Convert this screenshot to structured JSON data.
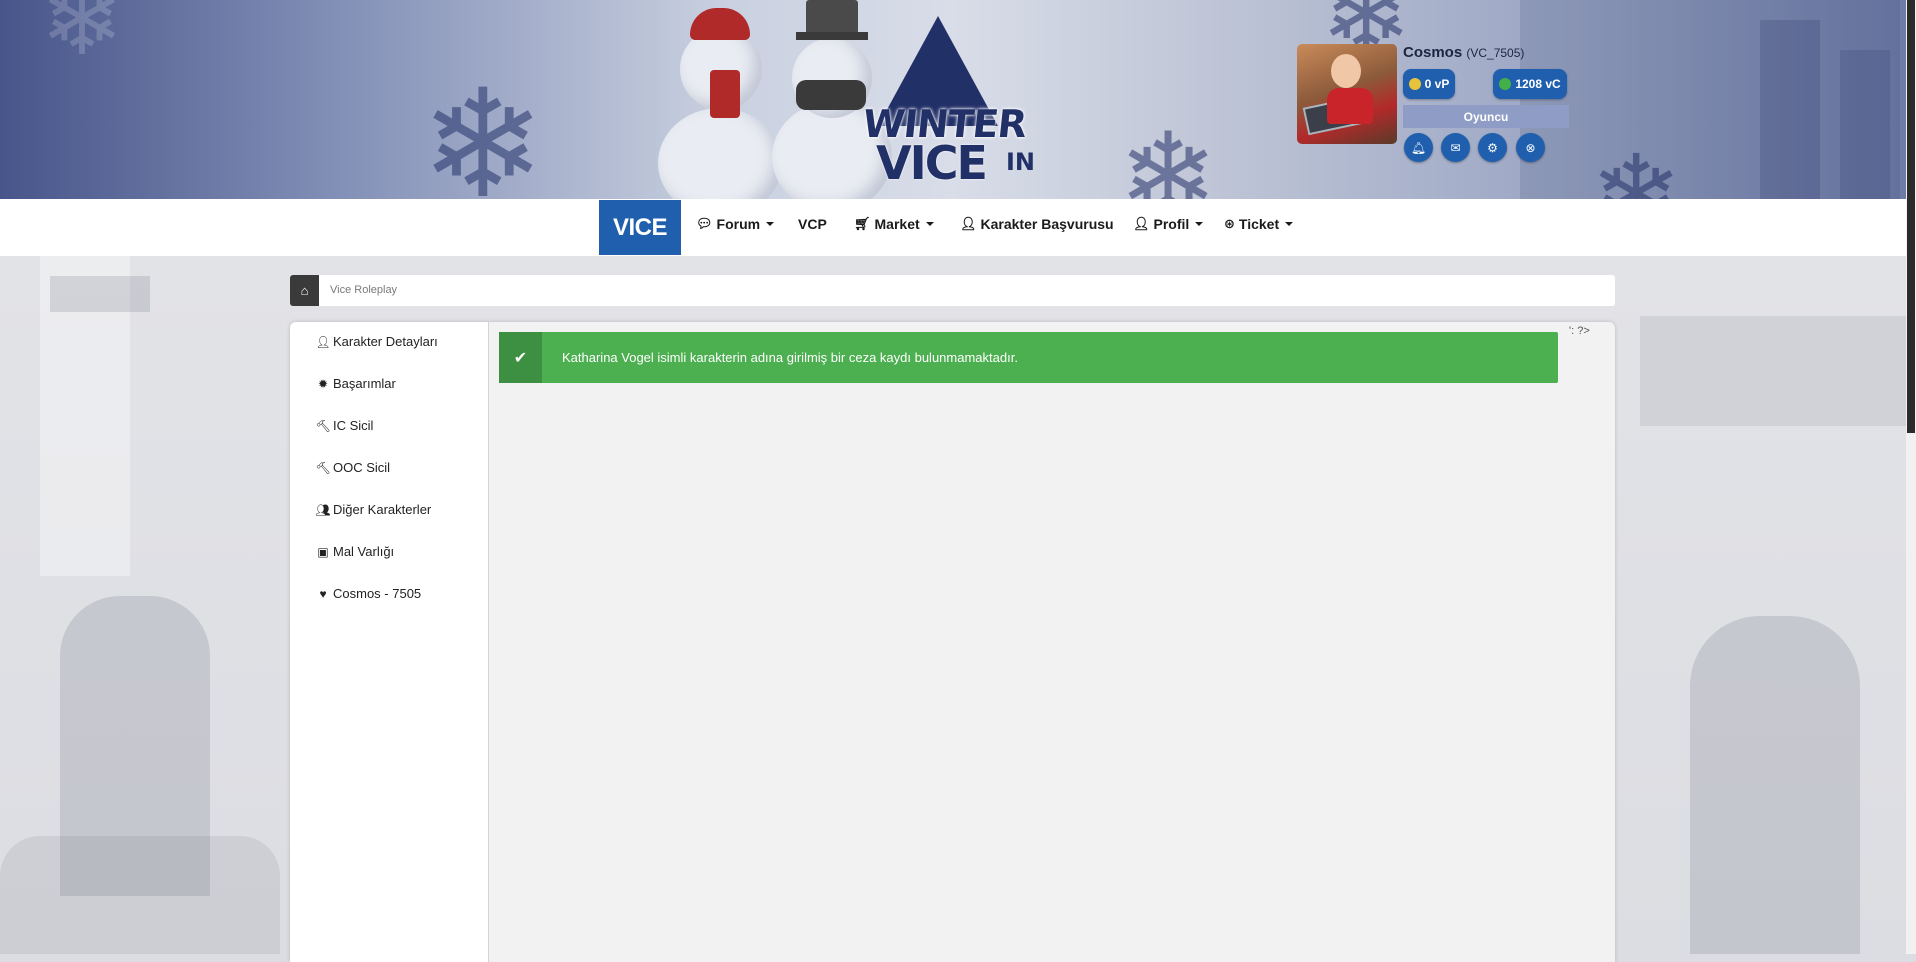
{
  "banner": {
    "logo": {
      "line1": "WINTER",
      "line2": "VICE",
      "line3": "IN"
    }
  },
  "user": {
    "name": "Cosmos",
    "id": "(VC_7505)",
    "vp": "0 vP",
    "vc": "1208 vC",
    "role": "Oyuncu"
  },
  "nav": {
    "brand": "VICE",
    "items": [
      "Forum",
      "VCP",
      "Market",
      "Karakter Başvurusu",
      "Profil",
      "Ticket"
    ]
  },
  "breadcrumb": {
    "text": "Vice Roleplay"
  },
  "sidebar": {
    "items": [
      "Karakter Detayları",
      "Başarımlar",
      "IC Sicil",
      "OOC Sicil",
      "Diğer Karakterler",
      "Mal Varlığı",
      "Cosmos - 7505"
    ]
  },
  "alert": {
    "message": "Katharina Vogel isimli karakterin adına girilmiş bir ceza kaydı bulunmamaktadır."
  },
  "stray_text": "': ?>",
  "colors": {
    "accent": "#1f5fae",
    "success": "#4caf50",
    "success_dark": "#3d8f41",
    "role": "#8f9cc6"
  }
}
